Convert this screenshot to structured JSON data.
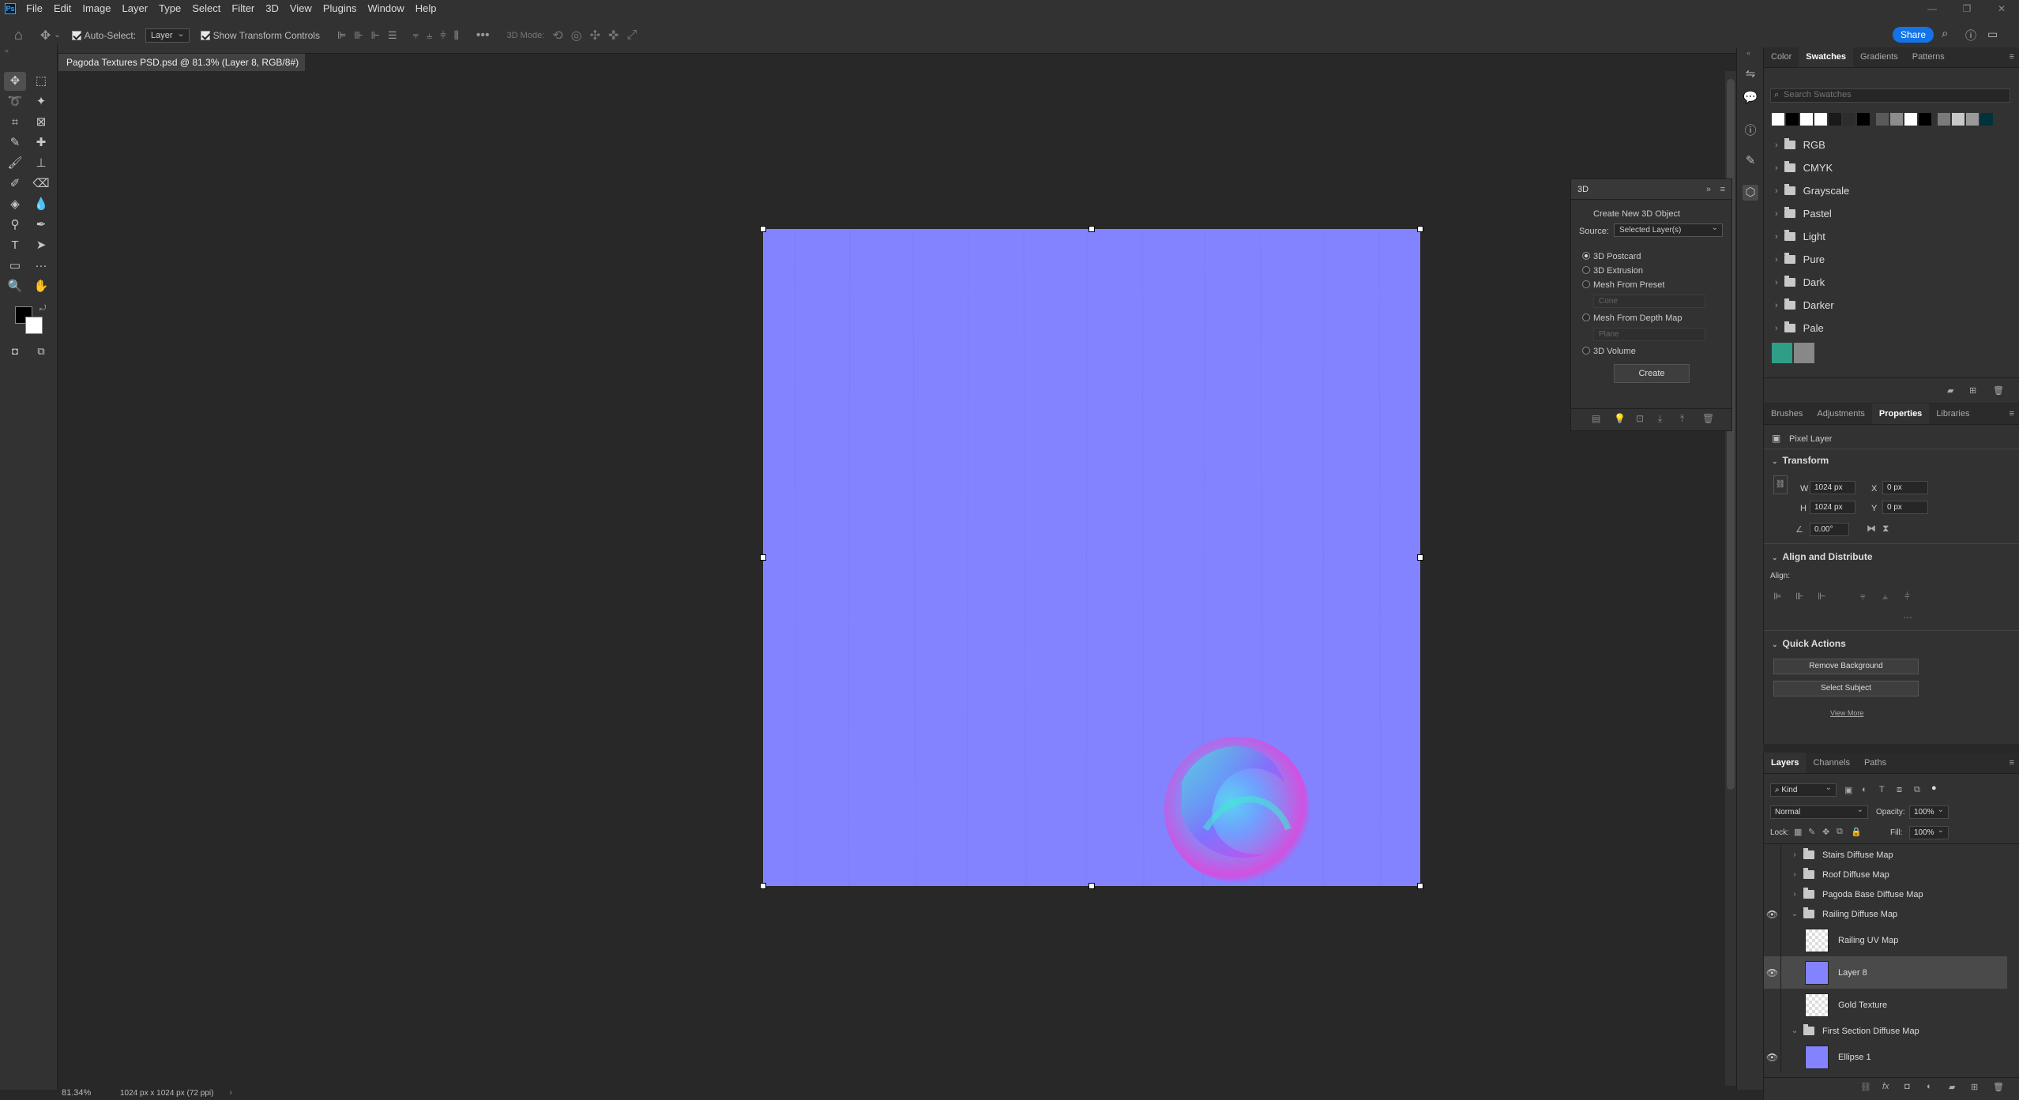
{
  "menu": {
    "logo": "Ps",
    "items": [
      "File",
      "Edit",
      "Image",
      "Layer",
      "Type",
      "Select",
      "Filter",
      "3D",
      "View",
      "Plugins",
      "Window",
      "Help"
    ]
  },
  "options_bar": {
    "auto_select_label": "Auto-Select:",
    "auto_select_value": "Layer",
    "show_transform_label": "Show Transform Controls",
    "mode_3d_label": "3D Mode:",
    "share_label": "Share"
  },
  "document": {
    "tab_title": "Pagoda Textures PSD.psd @ 81.3% (Layer 8, RGB/8#) *",
    "canvas_color": "#8383ff",
    "zoom": "81.34%",
    "doc_info": "1024 px x 1024 px (72 ppi)"
  },
  "panel_3d": {
    "title": "3D",
    "create_label": "Create New 3D Object",
    "source_label": "Source:",
    "source_value": "Selected Layer(s)",
    "options": [
      "3D Postcard",
      "3D Extrusion",
      "Mesh From Preset",
      "Mesh From Depth Map",
      "3D Volume"
    ],
    "selected_option": "3D Postcard",
    "preset_value": "Cone",
    "depth_value": "Plane",
    "create_button": "Create"
  },
  "swatches_panel": {
    "tabs": [
      "Color",
      "Swatches",
      "Gradients",
      "Patterns"
    ],
    "active_tab": "Swatches",
    "search_placeholder": "Search Swatches",
    "recent_colors": [
      "#ffffff",
      "#000000",
      "#ffffff",
      "#ffffff",
      "#1a1a1a",
      "#2d2d2d",
      "#000000",
      "#5a5a5a",
      "#8c8c8c",
      "#ffffff",
      "#000000",
      "#7a7a7a",
      "#c8c8c8",
      "#9a9a9a",
      "#00323c"
    ],
    "groups": [
      "RGB",
      "CMYK",
      "Grayscale",
      "Pastel",
      "Light",
      "Pure",
      "Dark",
      "Darker",
      "Pale"
    ],
    "extra_swatches": [
      "#2e9e86",
      "#888888"
    ]
  },
  "properties_panel": {
    "tabs": [
      "Brushes",
      "Adjustments",
      "Properties",
      "Libraries"
    ],
    "active_tab": "Properties",
    "layer_type": "Pixel Layer",
    "transform_label": "Transform",
    "w_label": "W",
    "w_value": "1024 px",
    "h_label": "H",
    "h_value": "1024 px",
    "x_label": "X",
    "x_value": "0 px",
    "y_label": "Y",
    "y_value": "0 px",
    "angle_value": "0.00°",
    "align_label": "Align and Distribute",
    "align_sub": "Align:",
    "quick_actions_label": "Quick Actions",
    "remove_bg": "Remove Background",
    "select_subject": "Select Subject",
    "view_more": "View More"
  },
  "layers_panel": {
    "tabs": [
      "Layers",
      "Channels",
      "Paths"
    ],
    "active_tab": "Layers",
    "kind_label": "Kind",
    "blend_mode": "Normal",
    "opacity_label": "Opacity:",
    "opacity_value": "100%",
    "lock_label": "Lock:",
    "fill_label": "Fill:",
    "fill_value": "100%",
    "layers": [
      {
        "name": "Stairs Diffuse Map",
        "type": "group",
        "visible": false
      },
      {
        "name": "Roof Diffuse Map",
        "type": "group",
        "visible": false
      },
      {
        "name": "Pagoda Base Diffuse Map",
        "type": "group",
        "visible": false
      },
      {
        "name": "Railing Diffuse Map",
        "type": "group",
        "visible": true
      },
      {
        "name": "Railing UV Map",
        "type": "layer",
        "visible": false
      },
      {
        "name": "Layer 8",
        "type": "layer",
        "visible": true,
        "selected": true
      },
      {
        "name": "Gold Texture",
        "type": "layer",
        "visible": false
      },
      {
        "name": "First Section Diffuse Map",
        "type": "group",
        "visible": false
      },
      {
        "name": "Ellipse 1",
        "type": "layer",
        "visible": true
      }
    ]
  }
}
